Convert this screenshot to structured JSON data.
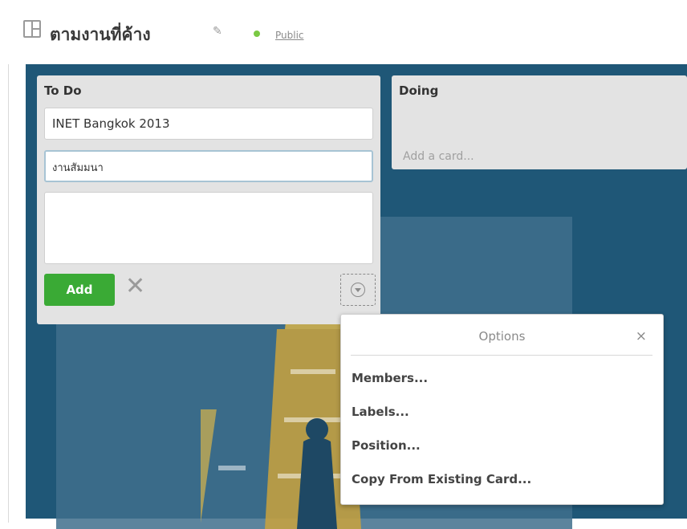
{
  "header": {
    "board_title": "ตามงานที่ค้าง",
    "visibility_label": "Public",
    "visibility_color": "#7ac943"
  },
  "colors": {
    "board_background": "#1f5777",
    "list_background": "#e3e3e3",
    "add_button": "#3aaa35"
  },
  "lists": {
    "todo": {
      "title": "To Do",
      "cards": [
        "INET Bangkok 2013"
      ],
      "composer_value": "งานสัมมนา",
      "add_label": "Add"
    },
    "doing": {
      "title": "Doing",
      "add_card_label": "Add a card..."
    }
  },
  "options_popover": {
    "title": "Options",
    "close_label": "×",
    "items": [
      "Members...",
      "Labels...",
      "Position...",
      "Copy From Existing Card..."
    ]
  },
  "icons": {
    "board": "board-icon",
    "edit": "pencil-icon",
    "cancel": "close-icon",
    "options": "chevron-down-icon"
  }
}
